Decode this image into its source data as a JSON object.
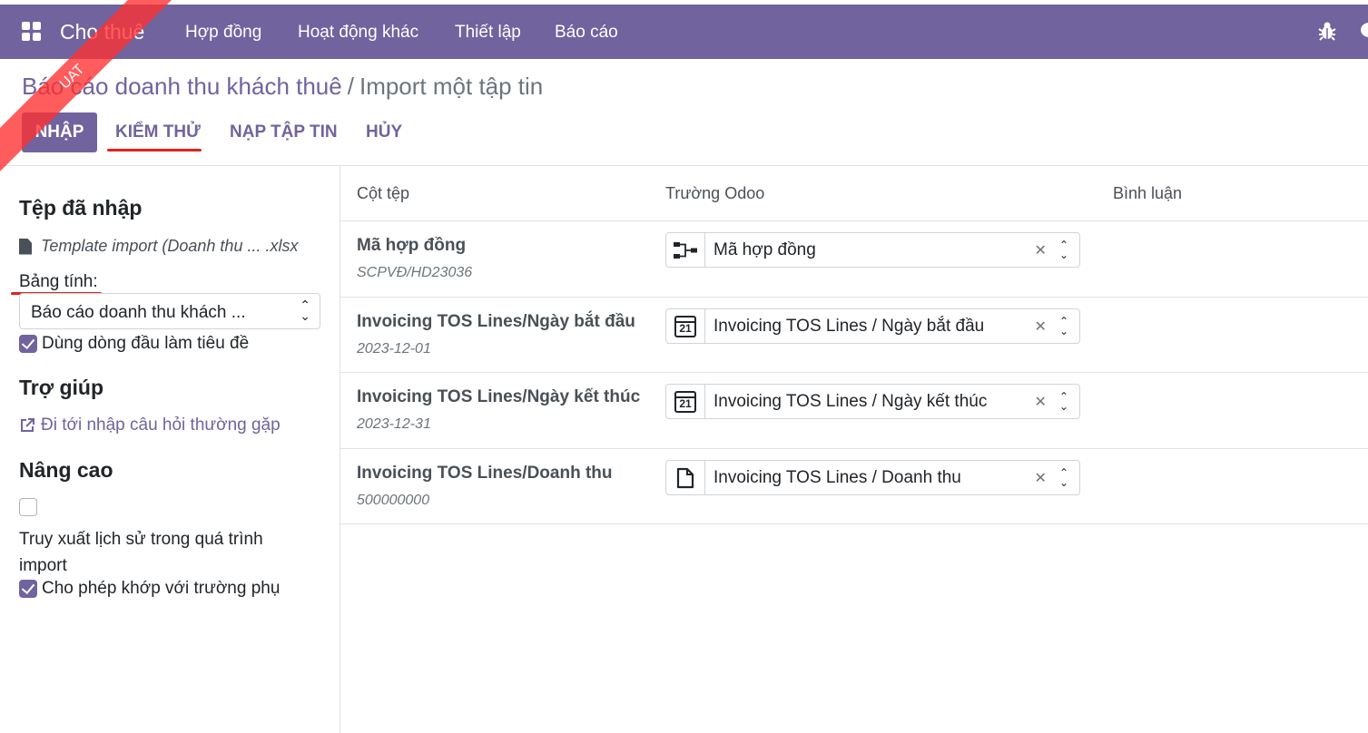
{
  "navbar": {
    "brand": "Cho thuê",
    "menu": [
      "Hợp đồng",
      "Hoạt động khác",
      "Thiết lập",
      "Báo cáo"
    ],
    "right_icons": [
      "bug-icon",
      "chat-icon"
    ],
    "color": "#71639e"
  },
  "ribbon": {
    "label": "UAT"
  },
  "breadcrumb": {
    "parent": "Báo cáo doanh thu khách thuê",
    "separator": "/",
    "current": "Import một tập tin"
  },
  "actions": {
    "import": "Nhập",
    "test": "Kiểm thử",
    "load_file": "Nạp tập tin",
    "cancel": "Hủy"
  },
  "sidebar": {
    "imported_file_heading": "Tệp đã nhập",
    "file_name": "Template import (Doanh thu ... .xlsx",
    "sheet_label": "Bảng tính:",
    "sheet_value": "Báo cáo doanh thu khách ...",
    "use_first_row": "Dùng dòng đầu làm tiêu đề",
    "help_heading": "Trợ giúp",
    "faq_link": "Đi tới nhập câu hỏi thường gặp",
    "advanced_heading": "Nâng cao",
    "track_history": "Truy xuất lịch sử trong quá trình import",
    "allow_subfields": "Cho phép khớp với trường phụ"
  },
  "table": {
    "headers": {
      "file_column": "Cột tệp",
      "odoo_field": "Trường Odoo",
      "comments": "Bình luận"
    },
    "rows": [
      {
        "column": "Mã hợp đồng",
        "sample": "SCPVĐ/HD23036",
        "icon": "relation-icon",
        "field": "Mã hợp đồng"
      },
      {
        "column": "Invoicing TOS Lines/Ngày bắt đầu",
        "sample": "2023-12-01",
        "icon": "calendar-icon",
        "field": "Invoicing TOS Lines / Ngày bắt đầu"
      },
      {
        "column": "Invoicing TOS Lines/Ngày kết thúc",
        "sample": "2023-12-31",
        "icon": "calendar-icon",
        "field": "Invoicing TOS Lines / Ngày kết thúc"
      },
      {
        "column": "Invoicing TOS Lines/Doanh thu",
        "sample": "500000000",
        "icon": "document-icon",
        "field": "Invoicing TOS Lines / Doanh thu"
      }
    ],
    "calendar_day": "21"
  }
}
